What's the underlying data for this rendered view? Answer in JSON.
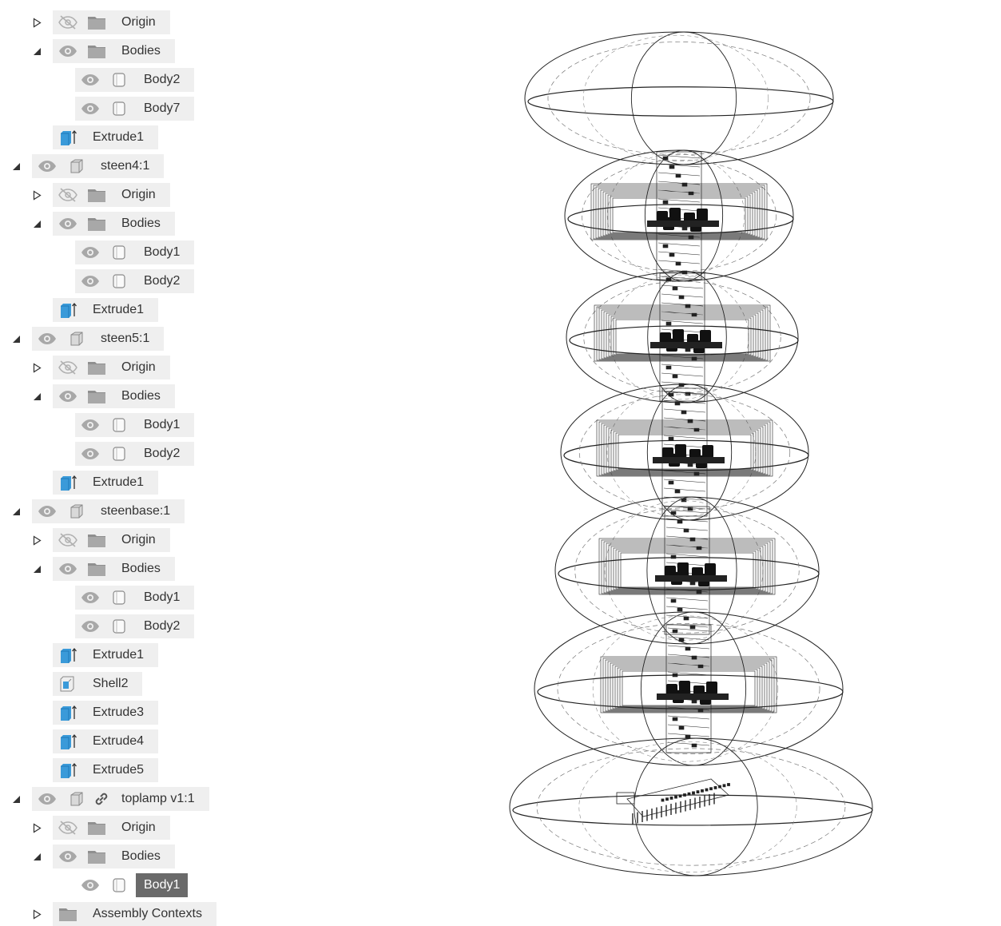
{
  "browser": {
    "rows": [
      {
        "label": "Origin",
        "indent": 1,
        "arrow": "collapsed",
        "eye": "hidden",
        "icon": "folder-icon"
      },
      {
        "label": "Bodies",
        "indent": 1,
        "arrow": "expanded",
        "eye": "visible",
        "icon": "folder-icon"
      },
      {
        "label": "Body2",
        "indent": 2,
        "arrow": "none",
        "eye": "visible",
        "icon": "body-icon"
      },
      {
        "label": "Body7",
        "indent": 2,
        "arrow": "none",
        "eye": "visible",
        "icon": "body-icon"
      },
      {
        "label": "Extrude1",
        "indent": 1,
        "arrow": "none",
        "eye": "none",
        "icon": "extrude-icon"
      },
      {
        "label": "steen4:1",
        "indent": 0,
        "arrow": "expanded",
        "eye": "visible",
        "icon": "component-icon"
      },
      {
        "label": "Origin",
        "indent": 1,
        "arrow": "collapsed",
        "eye": "hidden",
        "icon": "folder-icon"
      },
      {
        "label": "Bodies",
        "indent": 1,
        "arrow": "expanded",
        "eye": "visible",
        "icon": "folder-icon"
      },
      {
        "label": "Body1",
        "indent": 2,
        "arrow": "none",
        "eye": "visible",
        "icon": "body-icon"
      },
      {
        "label": "Body2",
        "indent": 2,
        "arrow": "none",
        "eye": "visible",
        "icon": "body-icon"
      },
      {
        "label": "Extrude1",
        "indent": 1,
        "arrow": "none",
        "eye": "none",
        "icon": "extrude-icon"
      },
      {
        "label": "steen5:1",
        "indent": 0,
        "arrow": "expanded",
        "eye": "visible",
        "icon": "component-icon"
      },
      {
        "label": "Origin",
        "indent": 1,
        "arrow": "collapsed",
        "eye": "hidden",
        "icon": "folder-icon"
      },
      {
        "label": "Bodies",
        "indent": 1,
        "arrow": "expanded",
        "eye": "visible",
        "icon": "folder-icon"
      },
      {
        "label": "Body1",
        "indent": 2,
        "arrow": "none",
        "eye": "visible",
        "icon": "body-icon"
      },
      {
        "label": "Body2",
        "indent": 2,
        "arrow": "none",
        "eye": "visible",
        "icon": "body-icon"
      },
      {
        "label": "Extrude1",
        "indent": 1,
        "arrow": "none",
        "eye": "none",
        "icon": "extrude-icon"
      },
      {
        "label": "steenbase:1",
        "indent": 0,
        "arrow": "expanded",
        "eye": "visible",
        "icon": "component-icon"
      },
      {
        "label": "Origin",
        "indent": 1,
        "arrow": "collapsed",
        "eye": "hidden",
        "icon": "folder-icon"
      },
      {
        "label": "Bodies",
        "indent": 1,
        "arrow": "expanded",
        "eye": "visible",
        "icon": "folder-icon"
      },
      {
        "label": "Body1",
        "indent": 2,
        "arrow": "none",
        "eye": "visible",
        "icon": "body-icon"
      },
      {
        "label": "Body2",
        "indent": 2,
        "arrow": "none",
        "eye": "visible",
        "icon": "body-icon"
      },
      {
        "label": "Extrude1",
        "indent": 1,
        "arrow": "none",
        "eye": "none",
        "icon": "extrude-icon"
      },
      {
        "label": "Shell2",
        "indent": 1,
        "arrow": "none",
        "eye": "none",
        "icon": "shell-icon"
      },
      {
        "label": "Extrude3",
        "indent": 1,
        "arrow": "none",
        "eye": "none",
        "icon": "extrude-icon"
      },
      {
        "label": "Extrude4",
        "indent": 1,
        "arrow": "none",
        "eye": "none",
        "icon": "extrude-icon"
      },
      {
        "label": "Extrude5",
        "indent": 1,
        "arrow": "none",
        "eye": "none",
        "icon": "extrude-icon"
      },
      {
        "label": "toplamp v1:1",
        "indent": 0,
        "arrow": "expanded",
        "eye": "visible",
        "icon": "component-icon",
        "linked": true
      },
      {
        "label": "Origin",
        "indent": 1,
        "arrow": "collapsed",
        "eye": "hidden",
        "icon": "folder-icon"
      },
      {
        "label": "Bodies",
        "indent": 1,
        "arrow": "expanded",
        "eye": "visible",
        "icon": "folder-icon"
      },
      {
        "label": "Body1",
        "indent": 2,
        "arrow": "none",
        "eye": "visible",
        "icon": "body-icon",
        "selected": true
      },
      {
        "label": "Assembly Contexts",
        "indent": 1,
        "arrow": "collapsed",
        "eye": "none",
        "icon": "folder-icon"
      }
    ]
  },
  "colors": {
    "row_bg": "#efefef",
    "selected_bg": "#6a6a6a",
    "icon_gray": "#9a9a9a",
    "feature_blue": "#3a9ad9",
    "wire": "#222222"
  }
}
